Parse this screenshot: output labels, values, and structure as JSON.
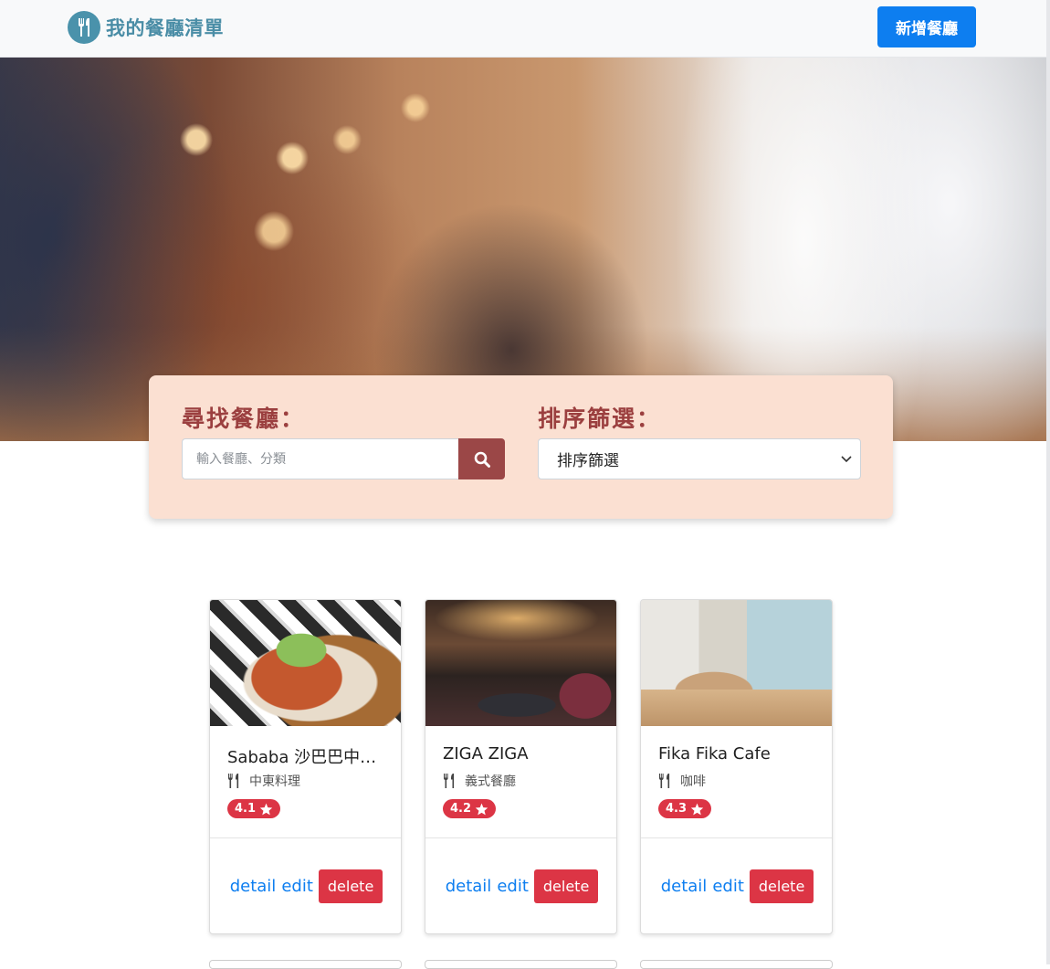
{
  "navbar": {
    "brand_title": "我的餐廳清單",
    "brand_icon": "utensils-icon",
    "add_button_label": "新增餐廳",
    "accent_color": "#4a8da6",
    "button_color": "#0d7ef0"
  },
  "search": {
    "search_label": "尋找餐廳：",
    "search_placeholder": "輸入餐廳、分類",
    "search_button_icon": "search-icon",
    "sort_label": "排序篩選：",
    "sort_selected": "排序篩選"
  },
  "restaurants": [
    {
      "name": "Sababa 沙巴巴中東美食",
      "category": "中東料理",
      "rating": "4.1"
    },
    {
      "name": "ZIGA ZIGA",
      "category": "義式餐廳",
      "rating": "4.2"
    },
    {
      "name": "Fika Fika Cafe",
      "category": "咖啡",
      "rating": "4.3"
    }
  ],
  "card_actions": {
    "detail_label": "detail",
    "edit_label": "edit",
    "delete_label": "delete"
  },
  "colors": {
    "panel_bg": "#fbe0d2",
    "panel_label": "#9b3f3f",
    "rating_badge": "#dc3545"
  }
}
